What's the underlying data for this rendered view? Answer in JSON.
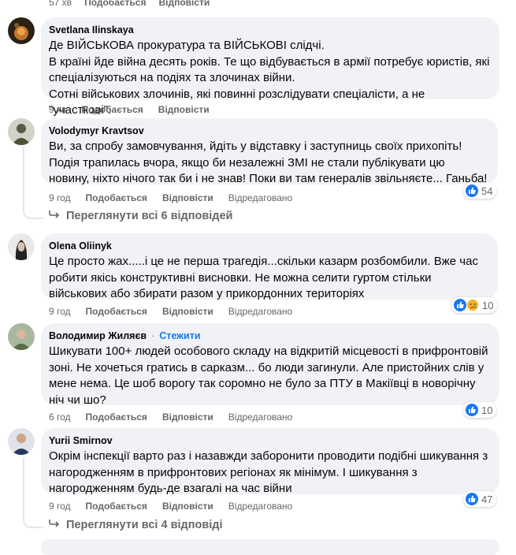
{
  "top_actions": {
    "time": "57 хв",
    "like": "Подобається",
    "reply": "Відповісти"
  },
  "comments": [
    {
      "author": "Svetlana Ilinskaya",
      "text": "Де ВІЙСЬКОВА прокуратура та ВІЙСЬКОВІ слідчі.\nВ країні йде війна десять років. Те що відбувається в армії потребує юристів, які спеціалізуються на подіях та злочинах війни.\nСотні військових злочинів, які повинні розслідувати спеціалісти, а не \"участкові\".",
      "time": "9 хв",
      "like": "Подобається",
      "reply": "Відповісти"
    },
    {
      "author": "Volodymyr Kravtsov",
      "text": "Ви, за спробу замовчування, йдіть у відставку і заступниць своїх прихопіть!\nПодія трапилась вчора, якщо би незалежні ЗМІ не стали публікувати цю новину, ніхто нічого так би і не знав! Поки ви там генералів звільняєте... Ганьба!",
      "time": "9 год",
      "like": "Подобається",
      "reply": "Відповісти",
      "edited": "Відредаговано",
      "reaction_count": "54"
    },
    {
      "author": "Olena Oliinyk",
      "text": "Це просто жах.....і це не перша трагедія...скільки казарм розбомбили. Вже час робити якісь конструктивні висновки. Не можна селити гуртом стільки військових або збирати разом у прикордонних територіях",
      "time": "9 год",
      "like": "Подобається",
      "reply": "Відповісти",
      "edited": "Відредаговано",
      "reaction_count": "10"
    },
    {
      "author": "Володимир Жиляєв",
      "follow": "Стежити",
      "text": "Шикувати 100+ людей особового складу на відкритій місцевості в прифронтовій зоні. Не хочеться гратись в сарказм... бо люди загинули. Але пристойних слів у мене нема. Це шоб ворогу так соромно не було за ПТУ в Макіївці в новорічну ніч чи шо?",
      "time": "6 год",
      "like": "Подобається",
      "reply": "Відповісти",
      "edited": "Відредаговано",
      "reaction_count": "10"
    },
    {
      "author": "Yurii Smirnov",
      "text": "Окрім інспекції варто раз і назавжди заборонити проводити подібні шикування з нагородженням в прифронтових регіонах як мінімум. І шикування з нагородженням будь-де взагалі на час війни",
      "time": "9 год",
      "like": "Подобається",
      "reply": "Відповісти",
      "edited": "Відредаговано",
      "reaction_count": "47"
    }
  ],
  "view_replies_1": "Переглянути всі 6 відповідей",
  "view_replies_2": "Переглянути всі 4 відповіді",
  "colors": {
    "bubble": "#f0f2f5",
    "meta": "#65676b",
    "link": "#1877f2",
    "like": "#1877f2",
    "sad": "#f7b125"
  }
}
